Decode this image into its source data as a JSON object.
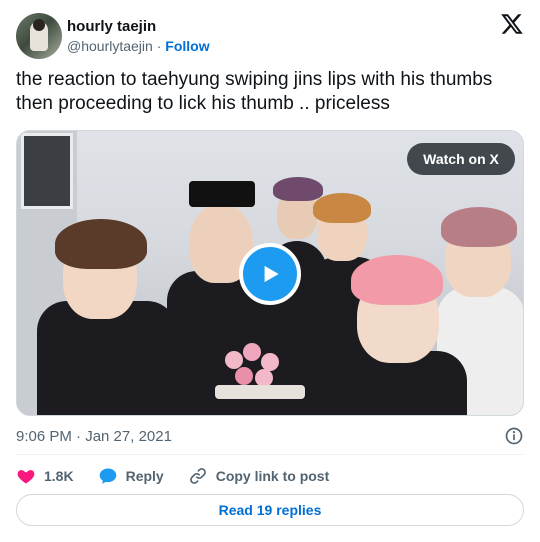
{
  "author": {
    "display_name": "hourly taejin",
    "handle": "@hourlytaejin",
    "separator": "·",
    "follow_label": "Follow"
  },
  "tweet": {
    "text": "the reaction to taehyung swiping jins lips with his thumbs then proceeding to lick his thumb .. priceless"
  },
  "media": {
    "watch_label": "Watch on X"
  },
  "meta": {
    "timestamp": "9:06 PM · Jan 27, 2021"
  },
  "actions": {
    "likes": "1.8K",
    "reply_label": "Reply",
    "copy_label": "Copy link to post"
  },
  "footer": {
    "read_replies": "Read 19 replies"
  },
  "colors": {
    "accent": "#1d9bf0",
    "link": "#006fd6",
    "like": "#f91880",
    "muted": "#536471"
  }
}
